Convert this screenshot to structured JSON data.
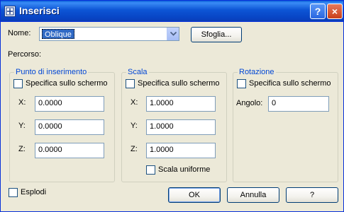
{
  "window": {
    "title": "Inserisci",
    "help_button": "?",
    "close_button": "×"
  },
  "name_row": {
    "label": "Nome:",
    "value": "Oblique",
    "browse_button": "Sfoglia..."
  },
  "path_label": "Percorso:",
  "insertion_point": {
    "title": "Punto di inserimento",
    "specify_on_screen": "Specifica sullo schermo",
    "x_label": "X:",
    "x_value": "0.0000",
    "y_label": "Y:",
    "y_value": "0.0000",
    "z_label": "Z:",
    "z_value": "0.0000"
  },
  "scale": {
    "title": "Scala",
    "specify_on_screen": "Specifica sullo schermo",
    "x_label": "X:",
    "x_value": "1.0000",
    "y_label": "Y:",
    "y_value": "1.0000",
    "z_label": "Z:",
    "z_value": "1.0000",
    "uniform_scale": "Scala uniforme"
  },
  "rotation": {
    "title": "Rotazione",
    "specify_on_screen": "Specifica sullo schermo",
    "angle_label": "Angolo:",
    "angle_value": "0"
  },
  "explode": "Esplodi",
  "buttons": {
    "ok": "OK",
    "cancel": "Annulla",
    "help": "?"
  },
  "colors": {
    "titlebar": "#0a55d5",
    "group_title": "#0046d5",
    "selection": "#316ac5",
    "dialog_bg": "#ece9d8"
  },
  "icons": {
    "title": "insert-block-icon",
    "combo_arrow": "chevron-down-icon"
  }
}
